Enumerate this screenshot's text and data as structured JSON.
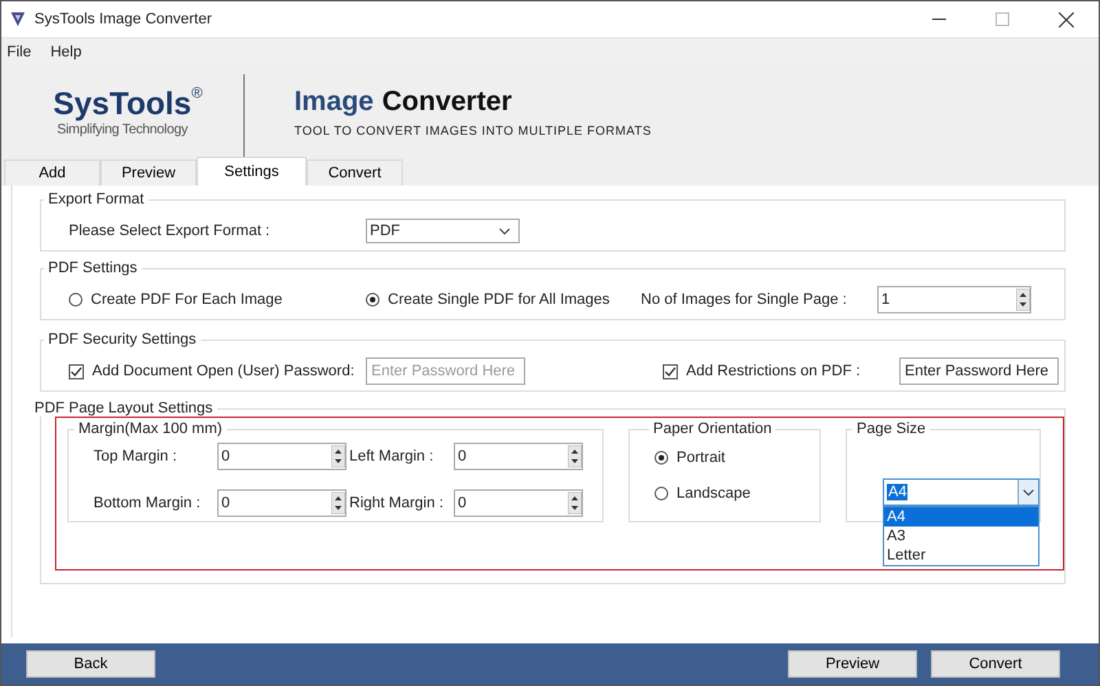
{
  "window": {
    "title": "SysTools Image Converter"
  },
  "menu": [
    "File",
    "Help"
  ],
  "banner": {
    "brand": "SysTools",
    "registered": "®",
    "tagline": "Simplifying Technology",
    "product_first": "Image",
    "product_second": "Converter",
    "subtitle": "TOOL TO CONVERT IMAGES INTO MULTIPLE FORMATS"
  },
  "tabs": [
    {
      "label": "Add",
      "selected": false
    },
    {
      "label": "Preview",
      "selected": false
    },
    {
      "label": "Settings",
      "selected": true
    },
    {
      "label": "Convert",
      "selected": false
    }
  ],
  "export_format": {
    "title": "Export Format",
    "label": "Please Select Export Format  :",
    "value": "PDF"
  },
  "pdf_settings": {
    "title": "PDF Settings",
    "options": [
      {
        "label": "Create PDF For Each Image",
        "selected": false
      },
      {
        "label": "Create Single PDF for All Images",
        "selected": true
      }
    ],
    "count_label": "No of Images for Single Page :",
    "count_value": "1"
  },
  "security": {
    "title": "PDF Security Settings",
    "items": [
      {
        "label": "Add Document Open (User) Password:",
        "checked": true,
        "placeholder": "Enter Password Here"
      },
      {
        "label": "Add Restrictions on PDF :",
        "checked": true,
        "value": "Enter Password Here"
      }
    ]
  },
  "layout": {
    "title": "PDF Page Layout Settings",
    "highlighted": true,
    "margin": {
      "title": "Margin(Max 100 mm)",
      "fields": [
        {
          "label": "Top Margin :",
          "value": "0"
        },
        {
          "label": "Left Margin :",
          "value": "0"
        },
        {
          "label": "Bottom Margin :",
          "value": "0"
        },
        {
          "label": "Right Margin :",
          "value": "0"
        }
      ]
    },
    "orientation": {
      "title": "Paper Orientation",
      "options": [
        {
          "label": "Portrait",
          "selected": true
        },
        {
          "label": "Landscape",
          "selected": false
        }
      ]
    },
    "page_size": {
      "title": "Page Size",
      "value": "A4",
      "expanded": true,
      "options": [
        {
          "label": "A4",
          "selected": true
        },
        {
          "label": "A3",
          "selected": false
        },
        {
          "label": "Letter",
          "selected": false
        }
      ]
    }
  },
  "footer": {
    "back": "Back",
    "preview": "Preview",
    "convert": "Convert"
  }
}
